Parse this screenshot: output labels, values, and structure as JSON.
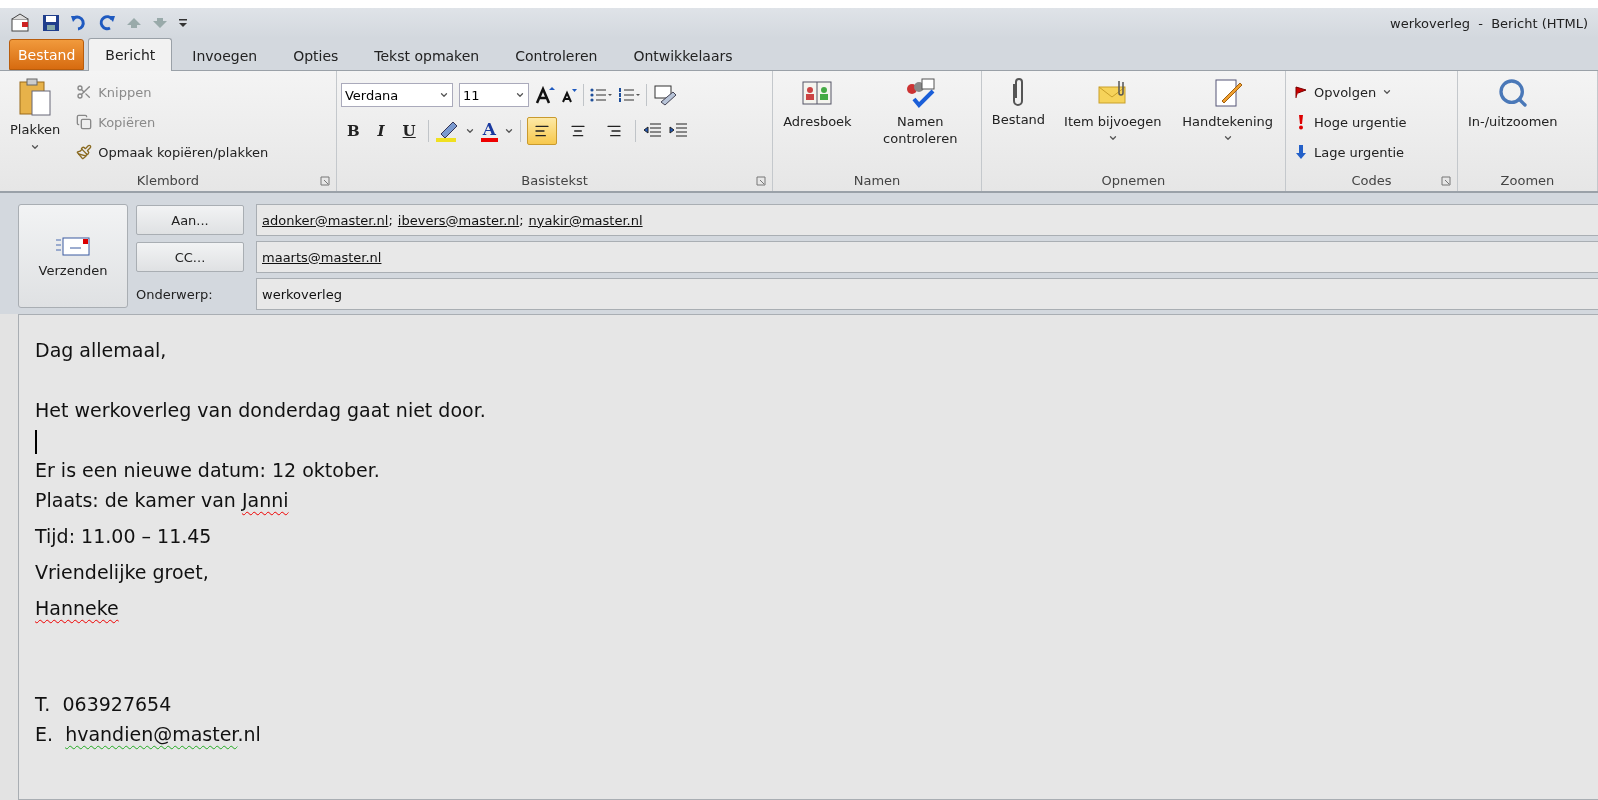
{
  "window": {
    "title": "werkoverleg  -  Bericht (HTML)"
  },
  "tabs": [
    {
      "label": "Bestand",
      "kind": "file",
      "selected": false
    },
    {
      "label": "Bericht",
      "kind": "tab",
      "selected": true
    },
    {
      "label": "Invoegen",
      "kind": "tab",
      "selected": false
    },
    {
      "label": "Opties",
      "kind": "tab",
      "selected": false
    },
    {
      "label": "Tekst opmaken",
      "kind": "tab",
      "selected": false
    },
    {
      "label": "Controleren",
      "kind": "tab",
      "selected": false
    },
    {
      "label": "Ontwikkelaars",
      "kind": "tab",
      "selected": false
    }
  ],
  "ribbon": {
    "clipboard": {
      "label": "Klembord",
      "paste": "Plakken",
      "items": [
        {
          "label": "Knippen",
          "disabled": true
        },
        {
          "label": "Kopiëren",
          "disabled": true
        },
        {
          "label": "Opmaak kopiëren/plakken",
          "disabled": false
        }
      ]
    },
    "basic_text": {
      "label": "Basistekst",
      "font": "Verdana",
      "size": "11",
      "bold": "B",
      "italic": "I",
      "underline": "U",
      "font_color": "A",
      "alignments": [
        {
          "kind": "left",
          "selected": true
        },
        {
          "kind": "center",
          "selected": false
        },
        {
          "kind": "right",
          "selected": false
        }
      ]
    },
    "names": {
      "label": "Namen",
      "buttons": [
        {
          "label": "Adresboek",
          "dropdown": false
        },
        {
          "label": "Namen controleren",
          "dropdown": false
        }
      ]
    },
    "include": {
      "label": "Opnemen",
      "buttons": [
        {
          "label": "Bestand",
          "dropdown": false
        },
        {
          "label": "Item bijvoegen",
          "dropdown": true
        },
        {
          "label": "Handtekening",
          "dropdown": true
        }
      ]
    },
    "tags": {
      "label": "Codes",
      "items": [
        {
          "label": "Opvolgen",
          "dropdown": true
        },
        {
          "label": "Hoge urgentie",
          "dropdown": false
        },
        {
          "label": "Lage urgentie",
          "dropdown": false
        }
      ]
    },
    "zoom": {
      "label": "Zoomen",
      "button": "In-/uitzoomen"
    }
  },
  "header": {
    "send": "Verzenden",
    "to": {
      "button": "Aan...",
      "recipients": [
        {
          "address": "adonker@master.nl",
          "separator": ";"
        },
        {
          "address": "ibevers@master.nl",
          "separator": ";"
        },
        {
          "address": "nyakir@master.nl"
        }
      ]
    },
    "cc": {
      "button": "CC...",
      "recipients": [
        {
          "address": "maarts@master.nl"
        }
      ]
    },
    "subject": {
      "label": "Onderwerp:",
      "value": "werkoverleg"
    }
  },
  "body": [
    {
      "lines": [
        {
          "kind": "text",
          "segments": [
            {
              "text": "Dag allemaal,",
              "kind": "plain"
            }
          ]
        },
        {
          "kind": "blank"
        },
        {
          "kind": "text",
          "segments": [
            {
              "text": "Het werkoverleg van donderdag gaat niet door.",
              "kind": "plain"
            }
          ]
        },
        {
          "kind": "cursor"
        },
        {
          "kind": "text",
          "segments": [
            {
              "text": "Er is een nieuwe datum: 12 oktober.",
              "kind": "plain"
            }
          ]
        },
        {
          "kind": "text",
          "segments": [
            {
              "text": "Plaats: de kamer van ",
              "kind": "plain"
            },
            {
              "text": "Janni",
              "kind": "spelling"
            }
          ]
        }
      ]
    },
    {
      "lines": [
        {
          "kind": "text",
          "segments": [
            {
              "text": "Tijd: 11.00 – 11.45",
              "kind": "plain"
            }
          ]
        }
      ]
    },
    {
      "lines": [
        {
          "kind": "text",
          "segments": [
            {
              "text": "Vriendelijke groet,",
              "kind": "plain"
            }
          ]
        }
      ]
    },
    {
      "lines": [
        {
          "kind": "text",
          "segments": [
            {
              "text": "Hanneke",
              "kind": "spelling"
            }
          ]
        }
      ]
    },
    {
      "lines": [
        {
          "kind": "blank"
        },
        {
          "kind": "blank"
        },
        {
          "kind": "text",
          "segments": [
            {
              "text": "T.  063927654",
              "kind": "plain"
            }
          ]
        },
        {
          "kind": "text",
          "segments": [
            {
              "text": "E.  ",
              "kind": "plain"
            },
            {
              "text": "hvandien@master",
              "kind": "grammar"
            },
            {
              "text": ".nl",
              "kind": "plain"
            }
          ]
        }
      ]
    }
  ]
}
